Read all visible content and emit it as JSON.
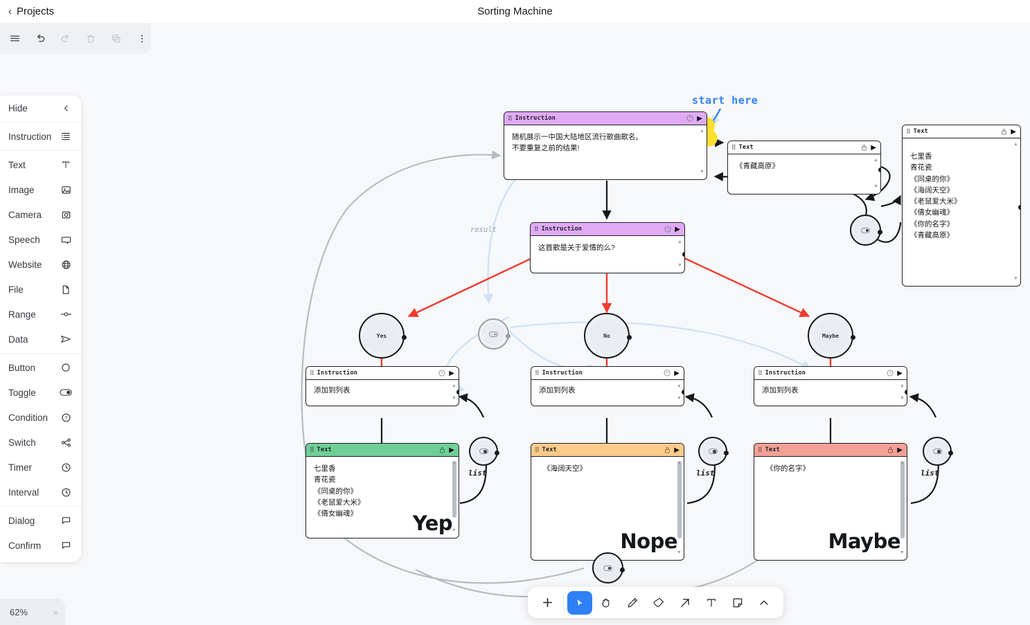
{
  "header": {
    "back_label": "Projects",
    "back_icon": "chevron-left-icon",
    "title": "Sorting Machine"
  },
  "top_toolbar": {
    "buttons": [
      {
        "name": "menu-button",
        "icon": "hamburger-icon",
        "enabled": true
      },
      {
        "name": "undo-button",
        "icon": "undo-arrow-icon",
        "enabled": true
      },
      {
        "name": "redo-button",
        "icon": "redo-arrow-icon",
        "enabled": false
      },
      {
        "name": "delete-button",
        "icon": "trash-icon",
        "enabled": false
      },
      {
        "name": "duplicate-button",
        "icon": "copy-icon",
        "enabled": false
      },
      {
        "name": "more-button",
        "icon": "kebab-menu-icon",
        "enabled": true
      }
    ]
  },
  "sidebar": {
    "hide_label": "Hide",
    "hide_icon": "chevron-left-icon",
    "groups": [
      {
        "items": [
          {
            "label": "Instruction",
            "icon": "list-instruction-icon"
          }
        ]
      },
      {
        "items": [
          {
            "label": "Text",
            "icon": "text-t-icon"
          },
          {
            "label": "Image",
            "icon": "image-icon"
          },
          {
            "label": "Camera",
            "icon": "camera-icon"
          },
          {
            "label": "Speech",
            "icon": "speech-bubble-icon"
          },
          {
            "label": "Website",
            "icon": "globe-icon"
          },
          {
            "label": "File",
            "icon": "file-icon"
          },
          {
            "label": "Range",
            "icon": "range-slider-icon"
          },
          {
            "label": "Data",
            "icon": "send-data-icon"
          }
        ]
      },
      {
        "items": [
          {
            "label": "Button",
            "icon": "circle-button-icon"
          },
          {
            "label": "Toggle",
            "icon": "toggle-switch-icon"
          },
          {
            "label": "Condition",
            "icon": "question-circle-icon"
          },
          {
            "label": "Switch",
            "icon": "share-switch-icon"
          },
          {
            "label": "Timer",
            "icon": "clock-icon"
          },
          {
            "label": "Interval",
            "icon": "clock-icon"
          }
        ]
      },
      {
        "items": [
          {
            "label": "Dialog",
            "icon": "dialog-bubble-icon"
          },
          {
            "label": "Confirm",
            "icon": "confirm-bubble-icon"
          }
        ]
      }
    ]
  },
  "zoom": {
    "level": "62%",
    "expand_icon": "double-chevron-right-icon"
  },
  "bottom_toolbar": {
    "tools": [
      {
        "name": "add-tool",
        "icon": "plus-icon",
        "active": false
      },
      {
        "name": "select-tool",
        "icon": "cursor-arrow-icon",
        "active": true
      },
      {
        "name": "pan-tool",
        "icon": "hand-icon",
        "active": false
      },
      {
        "name": "pen-tool",
        "icon": "pencil-icon",
        "active": false
      },
      {
        "name": "eraser-tool",
        "icon": "eraser-icon",
        "active": false
      },
      {
        "name": "arrow-tool",
        "icon": "arrow-up-right-icon",
        "active": false
      },
      {
        "name": "text-tool",
        "icon": "text-t-icon",
        "active": false
      },
      {
        "name": "note-tool",
        "icon": "sticky-note-icon",
        "active": false
      },
      {
        "name": "collapse-tool",
        "icon": "chevron-up-icon",
        "active": false
      }
    ]
  },
  "annotations": {
    "start_here": "start here",
    "result": "result",
    "list_yep": "list",
    "list_nope": "list",
    "list_maybe": "list"
  },
  "nodes": {
    "instruction_main": {
      "title": "Instruction",
      "help_icon": "question-circle-icon",
      "run_icon": "play-icon",
      "lines": [
        "随机展示一中国大陆地区流行歌曲歌名。",
        "不要重复之前的结果!"
      ]
    },
    "text_result": {
      "title": "Text",
      "lock_icon": "lock-icon",
      "run_icon": "play-icon",
      "lines": [
        "《青藏高原》"
      ]
    },
    "text_history": {
      "title": "Text",
      "lock_icon": "lock-icon",
      "run_icon": "play-icon",
      "lines": [
        "七里香",
        "青花瓷",
        "《同桌的你》",
        "《海阔天空》",
        "《老鼠爱大米》",
        "《倩女幽魂》",
        "《你的名字》",
        "《青藏高原》"
      ]
    },
    "instruction_question": {
      "title": "Instruction",
      "help_icon": "question-circle-icon",
      "run_icon": "play-icon",
      "lines": [
        "这首歌是关于爱情的么?"
      ]
    },
    "cond_yes": {
      "label": "Yes"
    },
    "cond_no": {
      "label": "No"
    },
    "cond_maybe": {
      "label": "Maybe"
    },
    "instruction_add_yes": {
      "title": "Instruction",
      "help_icon": "question-circle-icon",
      "run_icon": "play-icon",
      "lines": [
        "添加到列表"
      ]
    },
    "instruction_add_no": {
      "title": "Instruction",
      "help_icon": "question-circle-icon",
      "run_icon": "play-icon",
      "lines": [
        "添加到列表"
      ]
    },
    "instruction_add_maybe": {
      "title": "Instruction",
      "help_icon": "question-circle-icon",
      "run_icon": "play-icon",
      "lines": [
        "添加到列表"
      ]
    },
    "text_yep": {
      "title": "Text",
      "lock_icon": "lock-icon",
      "run_icon": "play-icon",
      "badge": "Yep",
      "lines": [
        "七里香",
        "青花瓷",
        "《同桌的你》",
        "《老鼠爱大米》",
        "《倩女幽魂》"
      ]
    },
    "text_nope": {
      "title": "Text",
      "lock_icon": "lock-icon",
      "run_icon": "play-icon",
      "badge": "Nope",
      "lines": [
        "《海阔天空》"
      ]
    },
    "text_maybe": {
      "title": "Text",
      "lock_icon": "lock-icon",
      "run_icon": "play-icon",
      "badge": "Maybe",
      "lines": [
        "《你的名字》"
      ]
    },
    "toggle_top_right": {
      "icon": "toggle-switch-icon"
    },
    "toggle_center": {
      "icon": "toggle-switch-icon"
    },
    "toggle_yep": {
      "icon": "toggle-switch-icon"
    },
    "toggle_nope": {
      "icon": "toggle-switch-icon"
    },
    "toggle_maybe": {
      "icon": "toggle-switch-icon"
    },
    "toggle_bottom": {
      "icon": "toggle-switch-icon"
    }
  },
  "colors": {
    "accent": "#2f80f5",
    "instruction_head": "#e0aaf5",
    "yep_head": "#6fcf97",
    "nope_head": "#fbcb8a",
    "maybe_head": "#f3a096",
    "highlight": "#ffe02e",
    "edge_red": "#ef3b2d",
    "edge_black": "#15181c",
    "edge_blue": "#cfe2f7",
    "edge_gray": "#b7bcc2"
  }
}
